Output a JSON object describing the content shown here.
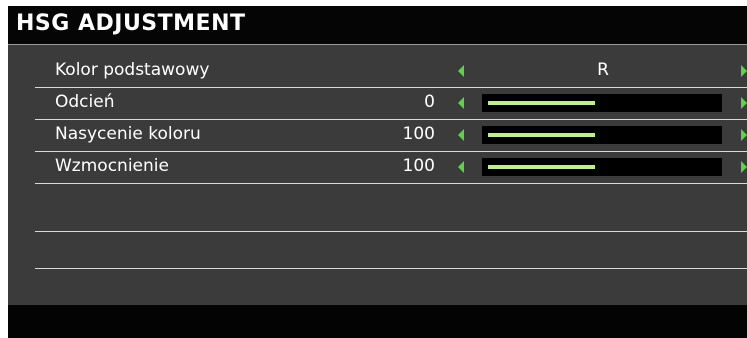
{
  "title": "HSG ADJUSTMENT",
  "rows": [
    {
      "label": "Kolor podstawowy",
      "value": "",
      "choice": "R"
    },
    {
      "label": "Odcień",
      "value": "0",
      "level_fraction": 0.47
    },
    {
      "label": "Nasycenie koloru",
      "value": "100",
      "level_fraction": 0.47
    },
    {
      "label": "Wzmocnienie",
      "value": "100",
      "level_fraction": 0.47
    }
  ],
  "colors": {
    "arrow": "#5fd14a",
    "slider_fill": "#bff08e",
    "panel": "#3b3b3b",
    "title_bar": "#050505"
  }
}
